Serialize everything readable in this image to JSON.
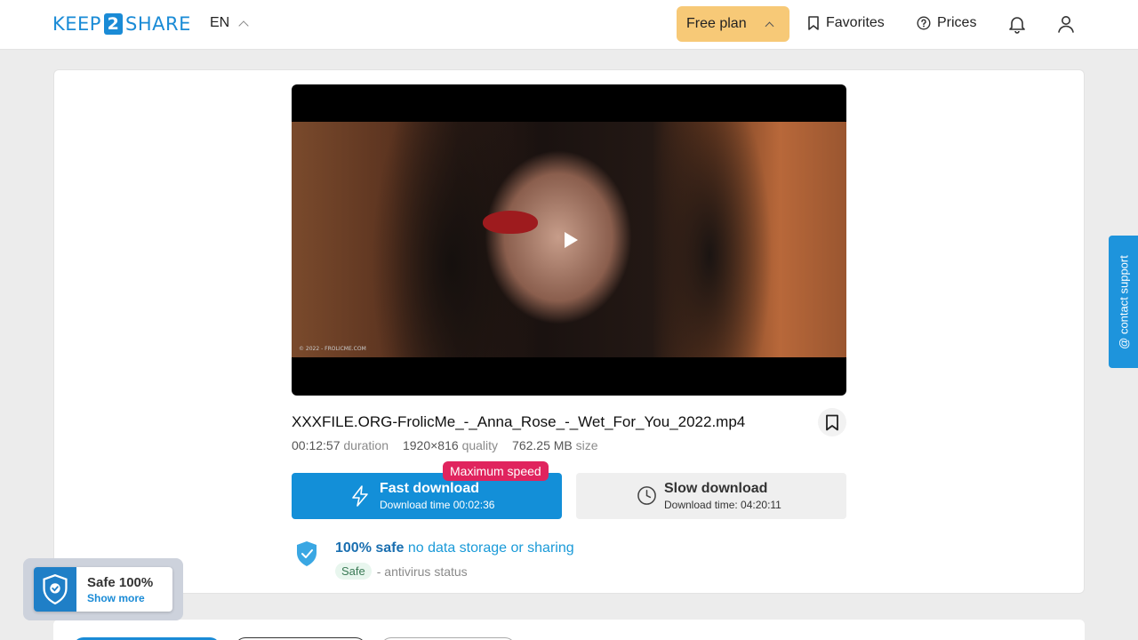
{
  "header": {
    "logo_left": "KEEP",
    "logo_mid": "2",
    "logo_right": "SHARE",
    "language": "EN",
    "plan_label": "Free plan",
    "favorites_label": "Favorites",
    "prices_label": "Prices"
  },
  "file": {
    "name": "XXXFILE.ORG-FrolicMe_-_Anna_Rose_-_Wet_For_You_2022.mp4",
    "duration_value": "00:12:57",
    "duration_label": "duration",
    "quality_value": "1920×816",
    "quality_label": "quality",
    "size_value": "762.25 MB",
    "size_label": "size",
    "video_watermark": "© 2022 - FROLICME.COM"
  },
  "download": {
    "badge": "Maximum speed",
    "fast_title": "Fast download",
    "fast_sub": "Download time 00:02:36",
    "slow_title": "Slow download",
    "slow_sub": "Download time: 04:20:11"
  },
  "safety": {
    "strong": "100% safe",
    "soft": "no data storage or sharing",
    "status_pill": "Safe",
    "status_text": "- antivirus status"
  },
  "support": {
    "label": "@ contact support"
  },
  "safe_widget": {
    "title": "Safe 100%",
    "link": "Show more"
  },
  "colors": {
    "brand": "#1a8bd6",
    "plan": "#f7c977",
    "fast": "#138fd8",
    "badge": "#e0245e"
  }
}
